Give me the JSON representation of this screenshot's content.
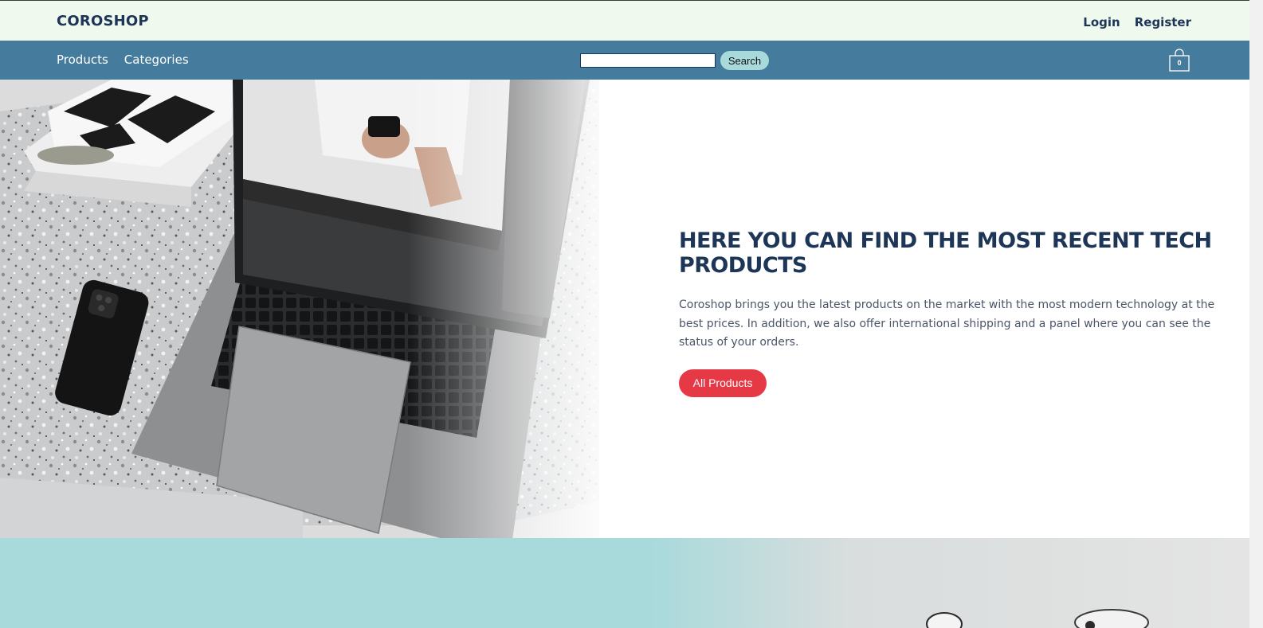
{
  "header": {
    "brand": "COROSHOP",
    "login_label": "Login",
    "register_label": "Register"
  },
  "nav": {
    "items": [
      {
        "label": "Products"
      },
      {
        "label": "Categories"
      }
    ],
    "search": {
      "value": "",
      "placeholder": "",
      "button_label": "Search"
    },
    "cart": {
      "icon": "shopping-bag-icon",
      "count": "0"
    }
  },
  "hero": {
    "image": "laptop-phone-desk-photo",
    "title": "HERE YOU CAN FIND THE MOST RECENT TECH PRODUCTS",
    "description": "Coroshop brings you the latest products on the market with the most modern technology at the best prices. In addition, we also offer international shipping and a panel where you can see the status of your orders.",
    "cta_label": "All Products"
  },
  "section2": {
    "image": "earbuds-photo"
  },
  "colors": {
    "topbar_bg": "#eff9ee",
    "navbar_bg": "#457b9d",
    "brand_text": "#1d3557",
    "accent_red": "#e63946",
    "accent_teal": "#a8dadc"
  }
}
